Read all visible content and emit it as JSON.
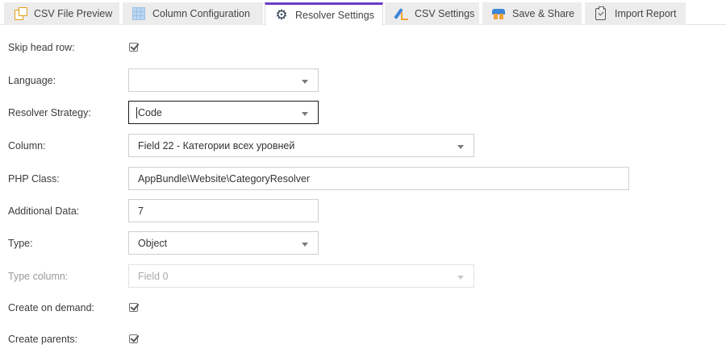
{
  "tabs": [
    {
      "label": "CSV File Preview",
      "icon": "file-preview-icon"
    },
    {
      "label": "Column Configuration",
      "icon": "grid-icon"
    },
    {
      "label": "Resolver Settings",
      "icon": "gear-icon",
      "active": true
    },
    {
      "label": "CSV Settings",
      "icon": "pen-icon"
    },
    {
      "label": "Save & Share",
      "icon": "save-share-icon"
    },
    {
      "label": "Import Report",
      "icon": "clipboard-check-icon"
    }
  ],
  "form": {
    "skip_head_row": {
      "label": "Skip head row:",
      "checked": true
    },
    "language": {
      "label": "Language:",
      "value": ""
    },
    "resolver_strategy": {
      "label": "Resolver Strategy:",
      "value": "Code"
    },
    "column": {
      "label": "Column:",
      "value": "Field 22 - Категории всех уровней"
    },
    "php_class": {
      "label": "PHP Class:",
      "value": "AppBundle\\Website\\CategoryResolver"
    },
    "additional_data": {
      "label": "Additional Data:",
      "value": "7"
    },
    "type": {
      "label": "Type:",
      "value": "Object"
    },
    "type_column": {
      "label": "Type column:",
      "value": "Field 0"
    },
    "create_on_demand": {
      "label": "Create on demand:",
      "checked": true
    },
    "create_parents": {
      "label": "Create parents:",
      "checked": true
    }
  },
  "colors": {
    "active_tab_accent": "#6a3cc7",
    "tab_bg": "#ececec"
  }
}
